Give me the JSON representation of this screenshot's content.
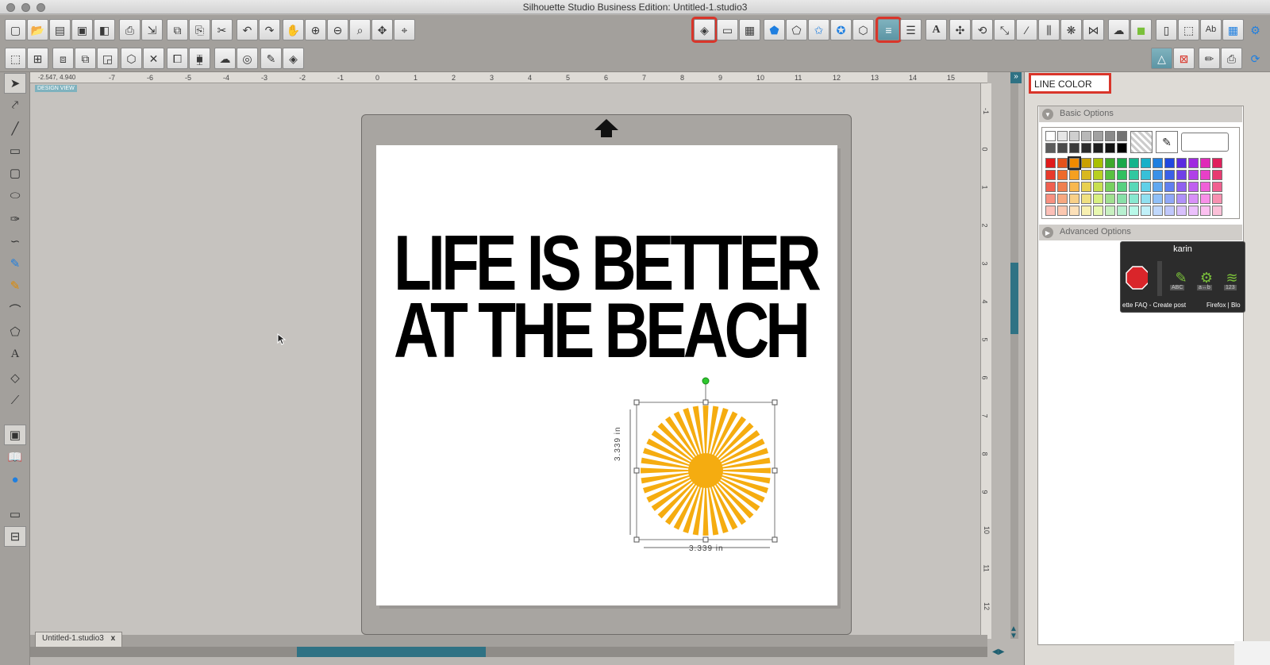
{
  "window": {
    "title": "Silhouette Studio Business Edition: Untitled-1.studio3"
  },
  "toolbar_top_left": [
    "new-document-icon",
    "open-icon",
    "pdf-icon",
    "save-icon",
    "save-to-library-icon",
    "print-icon",
    "print-cut-icon",
    "copy-icon",
    "paste-icon",
    "cut-icon",
    "undo-icon",
    "redo-icon",
    "pan-icon",
    "zoom-in-icon",
    "zoom-out-icon",
    "zoom-select-icon",
    "zoom-fit-icon",
    "fit-to-page-icon"
  ],
  "toolbar_top_right": [
    "fill-color-icon",
    "fill-gradient-icon",
    "fill-pattern-icon",
    "pentagon-icon",
    "shape-icon",
    "star-icon",
    "star-gear-icon",
    "polygon-icon",
    "line-color-icon",
    "line-style-icon",
    "text-style-icon",
    "transform-icon",
    "rotate-icon",
    "scale-icon",
    "shear-icon",
    "align-icon",
    "replicate-icon",
    "modify-icon",
    "offset-icon",
    "trace-icon",
    "library-icon",
    "cut-settings-icon",
    "page-setup-icon",
    "text-icon",
    "grid-icon",
    "settings-icon"
  ],
  "toolbar_second_left": [
    "select-all-icon",
    "deselect-icon",
    "group-icon",
    "ungroup-icon",
    "make-compound-icon",
    "release-compound-icon",
    "weld-icon",
    "delete-icon",
    "bring-forward-icon",
    "send-backward-icon",
    "cloud-icon",
    "offset-ring-icon",
    "knife-icon",
    "cube-icon"
  ],
  "toolbar_second_right": [
    "sketch-icon",
    "print-border-icon",
    "eraser-icon",
    "cut-mode-icon",
    "sync-icon"
  ],
  "ruler": {
    "coords": "-2.547, 4.940",
    "h_ticks": [
      "-7",
      "-6",
      "-5",
      "-4",
      "-3",
      "-2",
      "-1",
      "0",
      "1",
      "2",
      "3",
      "4",
      "5",
      "6",
      "7",
      "8",
      "9",
      "10",
      "11",
      "12",
      "13",
      "14",
      "15"
    ],
    "v_ticks": [
      "-1",
      "0",
      "1",
      "2",
      "3",
      "4",
      "5",
      "6",
      "7",
      "8",
      "9",
      "10",
      "11",
      "12"
    ]
  },
  "design_view_tag": "DESIGN VIEW",
  "left_tools": [
    "pointer-icon",
    "edit-points-icon",
    "line-icon",
    "rectangle-icon",
    "rounded-rectangle-icon",
    "ellipse-icon",
    "pen-icon",
    "curve-icon",
    "freehand-icon",
    "smooth-freehand-icon",
    "arc-icon",
    "polygon-icon",
    "text-icon",
    "eraser-icon",
    "knife-icon",
    "design-view-icon",
    "library-view-icon",
    "store-icon",
    "single-view-icon",
    "split-view-icon"
  ],
  "canvas": {
    "headline_line1": "LIFE IS BETTER",
    "headline_line2": "AT THE BEACH",
    "width_label": "3.339 in",
    "height_label": "3.339 in",
    "sun_color": "#f5ac10"
  },
  "doc_tab": {
    "label": "Untitled-1.studio3",
    "close": "x"
  },
  "panel": {
    "title": "LINE COLOR",
    "basic_options": "Basic Options",
    "advanced_options": "Advanced Options",
    "palette_rows": [
      [
        "#ffffff",
        "#e6e6e6",
        "#cfcfcf",
        "#b8b8b8",
        "#a1a1a1",
        "#8a8a8a",
        "#737373"
      ],
      [
        "#5c5c5c",
        "#4a4a4a",
        "#3a3a3a",
        "#2b2b2b",
        "#1f1f1f",
        "#121212",
        "#000000"
      ],
      [
        "#e01b1b",
        "#e3521b",
        "#f08a00",
        "#c9a000",
        "#a8c000",
        "#3ea82b",
        "#1aa84a",
        "#14b48c",
        "#19b0c8",
        "#1f7fe0",
        "#2048e0",
        "#5b2ae0",
        "#a02ae0",
        "#e02ab8",
        "#e0205c"
      ],
      [
        "#e83a2c",
        "#ef6a2a",
        "#f5a020",
        "#d8b820",
        "#b8d020",
        "#58c040",
        "#30c060",
        "#30c8a0",
        "#38c0d8",
        "#3a90e8",
        "#3a60e8",
        "#7040e8",
        "#b040e8",
        "#e840c8",
        "#e83a70"
      ],
      [
        "#f06050",
        "#f08050",
        "#f8b850",
        "#e8d050",
        "#c8e050",
        "#78d060",
        "#58d080",
        "#58d8b8",
        "#60d0e8",
        "#60a8f0",
        "#6080f0",
        "#9060f0",
        "#c060f0",
        "#f060d8",
        "#f06090"
      ],
      [
        "#f89080",
        "#f8a880",
        "#f8d088",
        "#f0e080",
        "#d8f080",
        "#a0e090",
        "#88e0a8",
        "#88e8d0",
        "#90e0f0",
        "#90c0f8",
        "#90a8f8",
        "#b090f8",
        "#d890f8",
        "#f890e8",
        "#f890b0"
      ],
      [
        "#fcc0b8",
        "#fcc8b0",
        "#fce0b8",
        "#f8f0b0",
        "#e8f8b0",
        "#c8f0c0",
        "#b8f0d0",
        "#b8f8e8",
        "#c0f0f8",
        "#c0d8fc",
        "#c0c8fc",
        "#d8c0fc",
        "#ecc0fc",
        "#fcc0f0",
        "#fcc0d8"
      ]
    ]
  },
  "popup": {
    "title": "karin",
    "abc_label": "ABC",
    "ab_label": "a↔b",
    "num_label": "123",
    "caption_left": "ette FAQ - Create post",
    "caption_right": "Firefox | Blo"
  }
}
